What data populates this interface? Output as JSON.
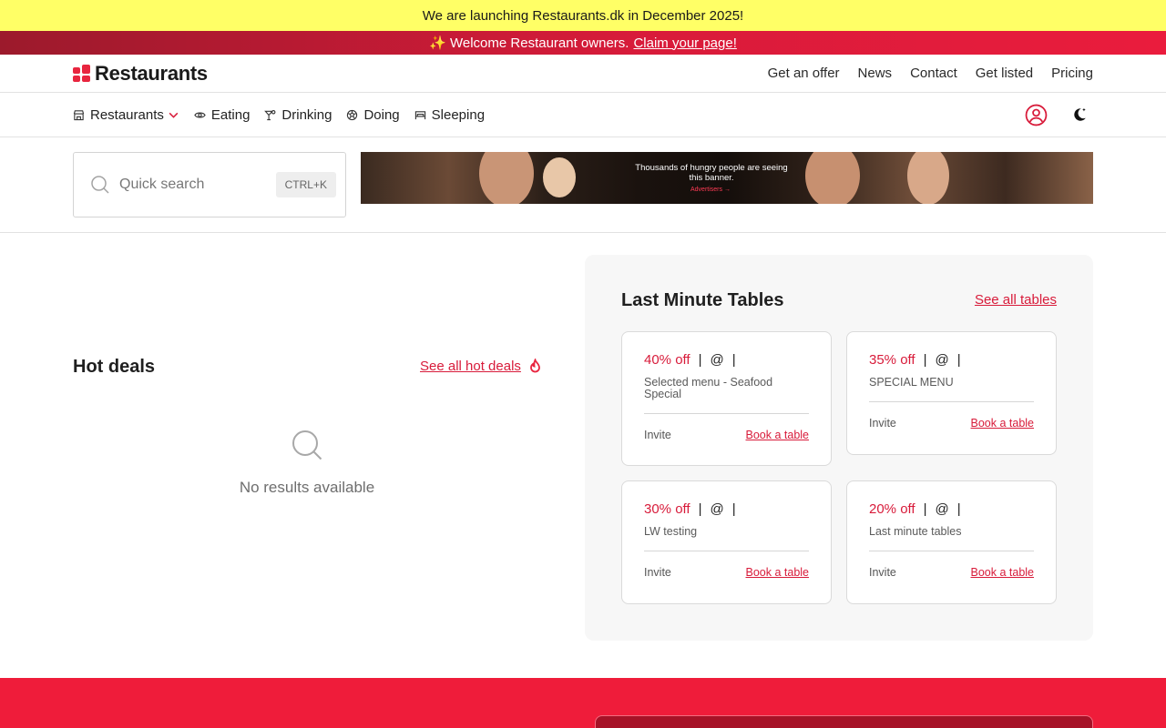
{
  "announcements": {
    "launch_text": "We are launching Restaurants.dk in December 2025!",
    "welcome_text": "✨ Welcome Restaurant owners.",
    "claim_link": "Claim your page!"
  },
  "header": {
    "logo_text": "Restaurants",
    "brand_color": "#e8253f",
    "nav": [
      "Get an offer",
      "News",
      "Contact",
      "Get listed",
      "Pricing"
    ]
  },
  "subnav": {
    "items": [
      {
        "label": "Restaurants",
        "icon": "storefront-icon"
      },
      {
        "label": "Eating",
        "icon": "eye-icon"
      },
      {
        "label": "Drinking",
        "icon": "cocktail-icon"
      },
      {
        "label": "Doing",
        "icon": "ball-icon"
      },
      {
        "label": "Sleeping",
        "icon": "bed-icon"
      }
    ],
    "user_icon": "user-circle-icon",
    "theme_icon": "moon-icon"
  },
  "search": {
    "placeholder": "Quick search",
    "shortcut": "CTRL+K"
  },
  "ad": {
    "headline": "Thousands of hungry people are seeing this banner.",
    "cta": "Advertisers →"
  },
  "hot_deals": {
    "title": "Hot deals",
    "link": "See all hot deals",
    "empty_text": "No results available"
  },
  "last_minute": {
    "title": "Last Minute Tables",
    "link": "See all tables",
    "cards": [
      {
        "discount": "40% off",
        "at": "@",
        "desc": "Selected menu - Seafood Special",
        "invite": "Invite",
        "book": "Book a table"
      },
      {
        "discount": "35% off",
        "at": "@",
        "desc": "SPECIAL MENU",
        "invite": "Invite",
        "book": "Book a table"
      },
      {
        "discount": "30% off",
        "at": "@",
        "desc": "LW testing",
        "invite": "Invite",
        "book": "Book a table"
      },
      {
        "discount": "20% off",
        "at": "@",
        "desc": "Last minute tables",
        "invite": "Invite",
        "book": "Book a table"
      }
    ]
  }
}
